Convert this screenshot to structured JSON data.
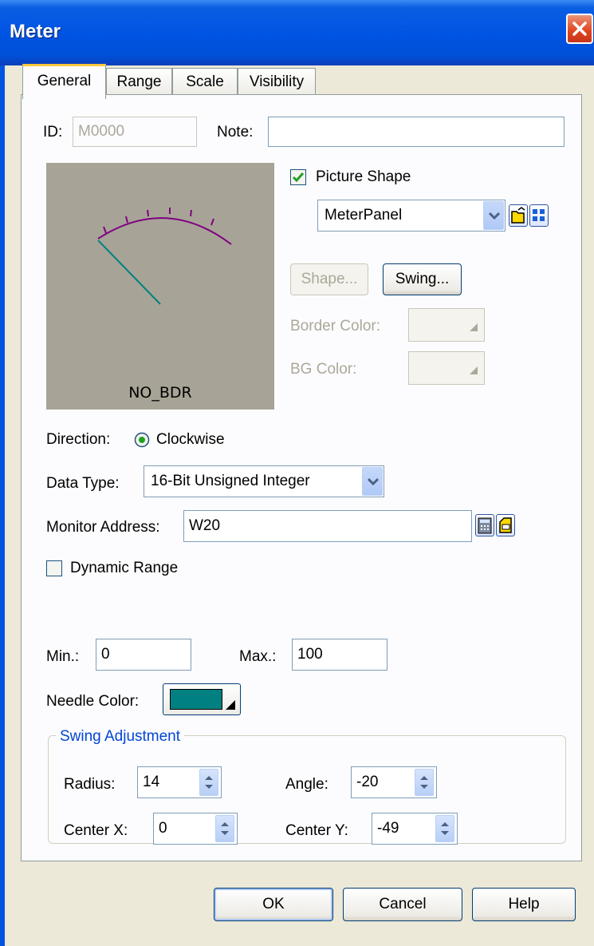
{
  "window": {
    "title": "Meter"
  },
  "tabs": [
    {
      "label": "General"
    },
    {
      "label": "Range"
    },
    {
      "label": "Scale"
    },
    {
      "label": "Visibility"
    }
  ],
  "general": {
    "id_label": "ID:",
    "id_value": "M0000",
    "note_label": "Note:",
    "note_value": "",
    "preview_caption": "NO_BDR",
    "picture_shape_label": "Picture Shape",
    "picture_shape_checked": true,
    "picture_shape_value": "MeterPanel",
    "shape_button": "Shape...",
    "swing_button": "Swing...",
    "border_color_label": "Border Color:",
    "bg_color_label": "BG Color:",
    "direction_label": "Direction:",
    "direction_value": "Clockwise",
    "data_type_label": "Data Type:",
    "data_type_value": "16-Bit Unsigned Integer",
    "monitor_address_label": "Monitor Address:",
    "monitor_address_value": "W20",
    "dynamic_range_label": "Dynamic Range",
    "dynamic_range_checked": false,
    "min_label": "Min.:",
    "min_value": "0",
    "max_label": "Max.:",
    "max_value": "100",
    "needle_color_label": "Needle Color:",
    "needle_color": "#008080",
    "swing": {
      "group_label": "Swing Adjustment",
      "radius_label": "Radius:",
      "radius_value": "14",
      "angle_label": "Angle:",
      "angle_value": "-20",
      "center_x_label": "Center X:",
      "center_x_value": "0",
      "center_y_label": "Center Y:",
      "center_y_value": "-49"
    }
  },
  "buttons": {
    "ok": "OK",
    "cancel": "Cancel",
    "help": "Help"
  },
  "colors": {
    "titlebar": "#0054e3",
    "dialog_bg": "#ece9d8",
    "preview_bg": "#a7a497",
    "meter_arc": "#800080",
    "needle": "#008080",
    "group_label": "#0046d5"
  }
}
